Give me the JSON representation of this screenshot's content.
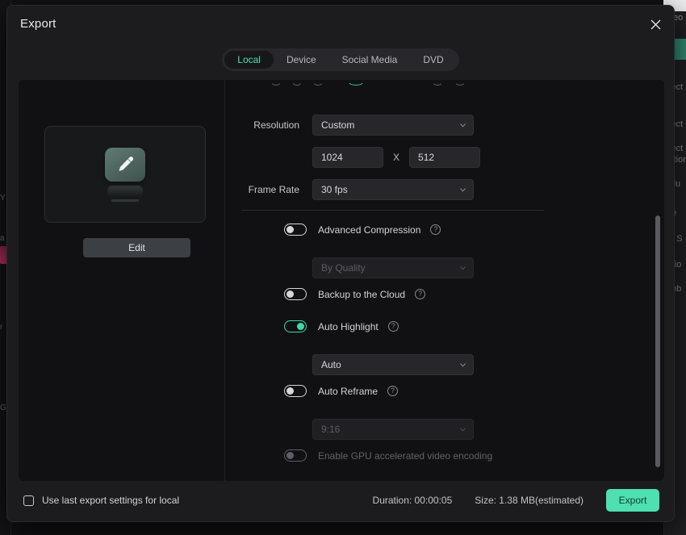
{
  "background": {
    "right_fragments": [
      "Preo",
      "oject",
      "oject",
      "oject",
      "cation",
      "solu",
      "me",
      "lor S",
      "ratio",
      "umb"
    ],
    "left_fragments": [
      "Y",
      "a",
      "r",
      "G"
    ]
  },
  "dialog": {
    "title": "Export",
    "close_icon": "close-icon"
  },
  "tabs": {
    "items": [
      {
        "label": "Local",
        "active": true
      },
      {
        "label": "Device",
        "active": false
      },
      {
        "label": "Social Media",
        "active": false
      },
      {
        "label": "DVD",
        "active": false
      }
    ]
  },
  "preview": {
    "thumbnail_icon": "pencil-edit-icon",
    "edit_label": "Edit"
  },
  "settings": {
    "resolution": {
      "label": "Resolution",
      "value": "Custom",
      "chevron_icon": "chevron-down-icon"
    },
    "dimensions": {
      "width": "1024",
      "height": "512",
      "separator": "X"
    },
    "frame_rate": {
      "label": "Frame Rate",
      "value": "30 fps",
      "chevron_icon": "chevron-down-icon"
    },
    "advanced_compression": {
      "label": "Advanced Compression",
      "enabled": false,
      "help_icon": "question-mark-icon",
      "dropdown_value": "By Quality",
      "dropdown_disabled": true
    },
    "backup_cloud": {
      "label": "Backup to the Cloud",
      "enabled": false,
      "help_icon": "question-mark-icon"
    },
    "auto_highlight": {
      "label": "Auto Highlight",
      "enabled": true,
      "help_icon": "question-mark-icon",
      "dropdown_value": "Auto",
      "dropdown_disabled": false
    },
    "auto_reframe": {
      "label": "Auto Reframe",
      "enabled": false,
      "help_icon": "question-mark-icon",
      "dropdown_value": "9:16",
      "dropdown_disabled": true
    },
    "gpu_encoding": {
      "label": "Enable GPU accelerated video encoding",
      "enabled": false,
      "disabled": true
    }
  },
  "footer": {
    "use_last_settings_label": "Use last export settings for local",
    "use_last_settings_checked": false,
    "duration": "Duration: 00:00:05",
    "size": "Size: 1.38 MB(estimated)",
    "export_label": "Export"
  },
  "colors": {
    "accent": "#4ee0b0",
    "toggle_on": "#3fd9a8",
    "dialog_bg": "#1c1c1f",
    "body_bg": "#111113"
  }
}
